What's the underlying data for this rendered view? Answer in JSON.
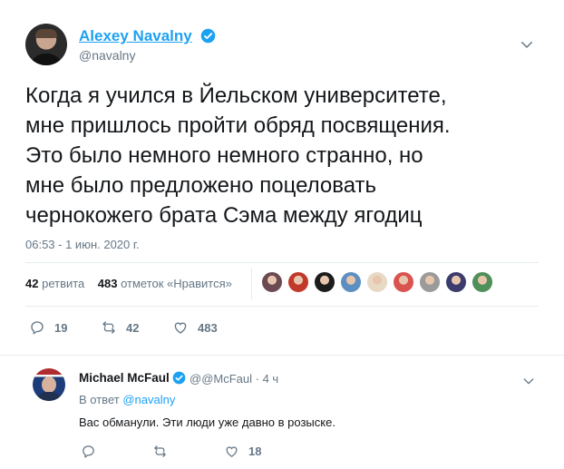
{
  "tweet": {
    "author_name": "Alexey Navalny",
    "author_handle": "@navalny",
    "text": "Когда я учился в Йельском университете,\nмне пришлось пройти обряд посвящения.\nЭто было немного немного странно, но\nмне было предложено поцеловать\nчернокожего брата Сэма между ягодиц",
    "timestamp": "06:53 - 1 июн. 2020 г."
  },
  "stats": {
    "retweets_count": "42",
    "retweets_label": "ретвита",
    "likes_count": "483",
    "likes_label": "отметок «Нравится»"
  },
  "likers": {
    "avatar_colors": [
      "#6b4a52",
      "#c0392b",
      "#1c1c1c",
      "#5d8fc2",
      "#e8d9c4",
      "#d9534f",
      "#9a9a9a",
      "#3b3b6d",
      "#4f8f5a"
    ]
  },
  "actions": {
    "reply_count": "19",
    "retweet_count": "42",
    "like_count": "483"
  },
  "reply": {
    "author_name": "Michael McFaul",
    "author_meta": "@@McFaul · 4 ч",
    "reply_to_label": "В ответ",
    "reply_to_mention": "@navalny",
    "text": "Вас обманули. Эти люди уже давно в розыске.",
    "reply_count": "",
    "retweet_count": "",
    "like_count": "18"
  },
  "colors": {
    "accent": "#1da1f2",
    "text_primary": "#14171a",
    "text_secondary": "#657786",
    "divider": "#e6ecf0"
  },
  "icons": [
    "verified-badge-icon",
    "chevron-down-icon",
    "reply-icon",
    "retweet-icon",
    "like-heart-icon"
  ]
}
